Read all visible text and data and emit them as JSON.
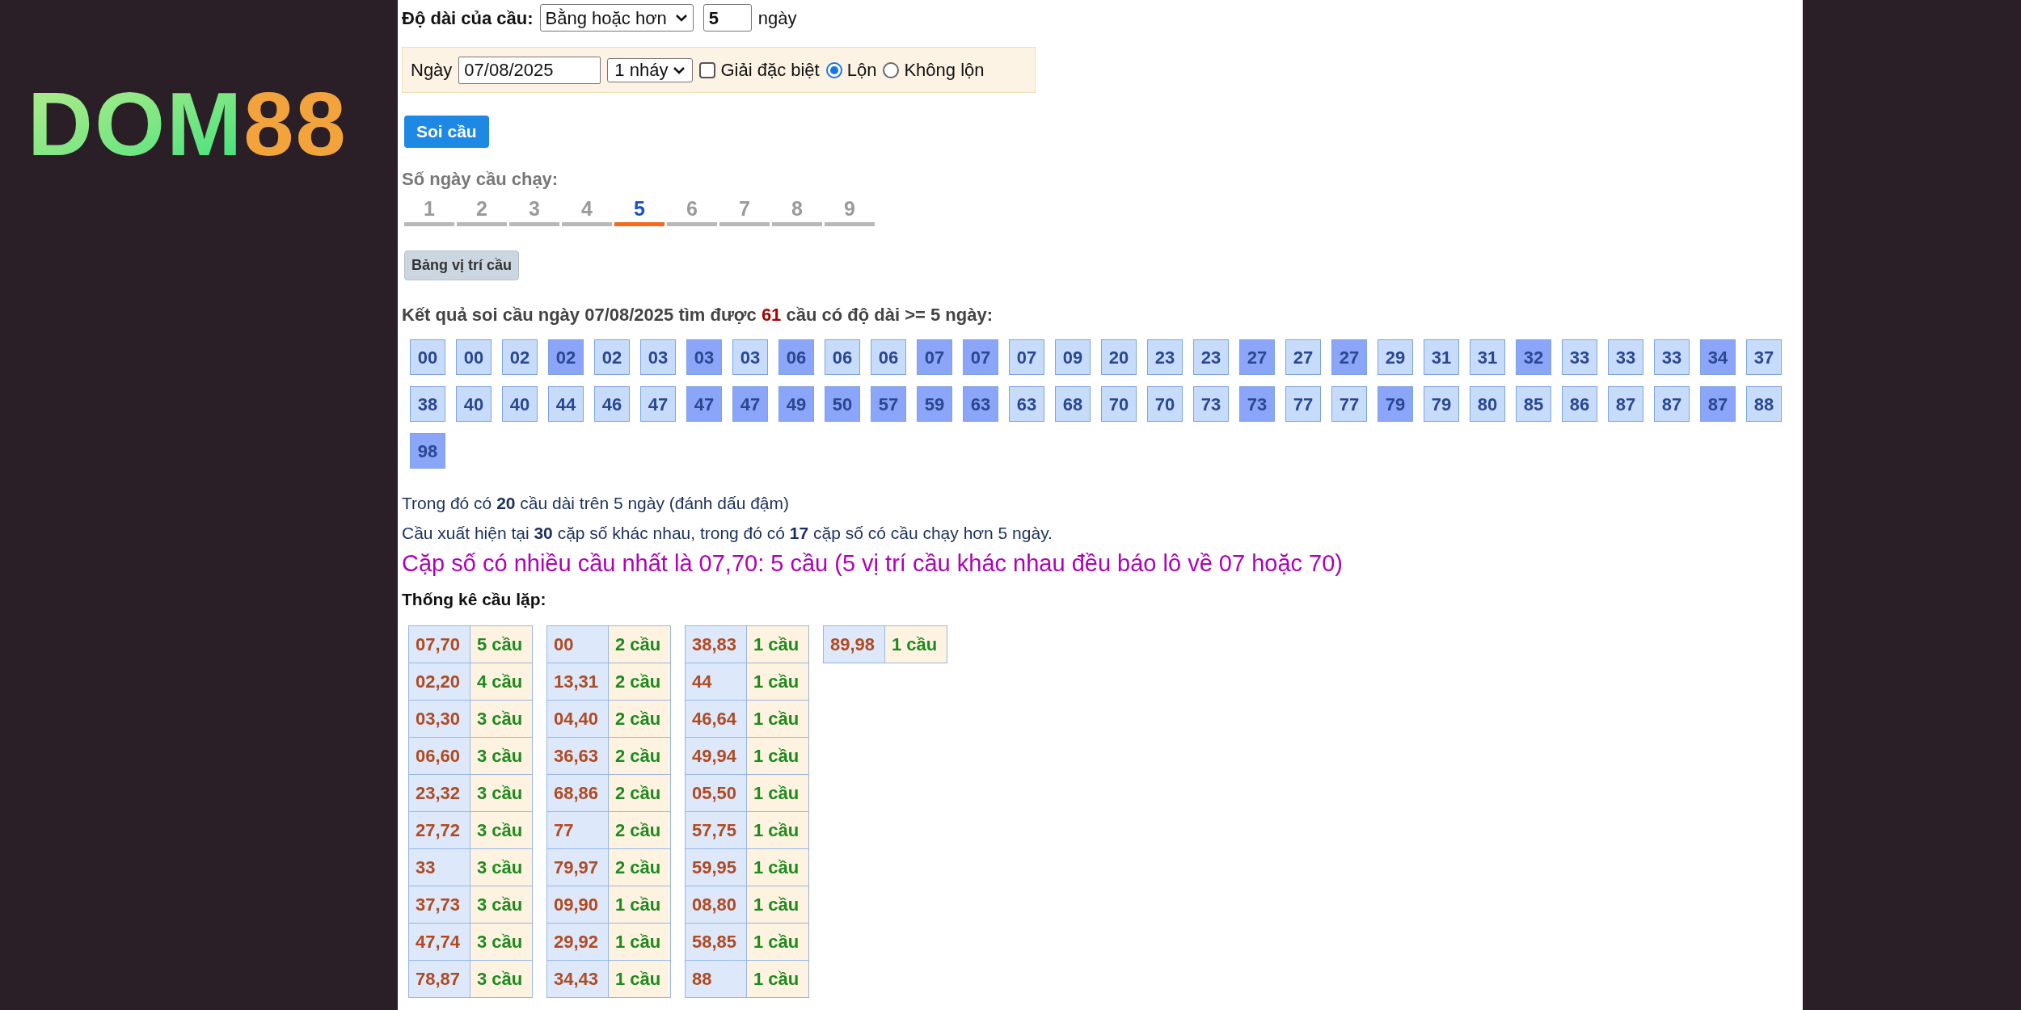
{
  "logo": {
    "text": "DOM",
    "accent": "88"
  },
  "length_filter": {
    "label": "Độ dài của cầu:",
    "mode": "Bằng hoặc hơn",
    "days": "5",
    "unit": "ngày"
  },
  "date_bar": {
    "label": "Ngày",
    "date": "07/08/2025",
    "count": "1 nháy",
    "options": [
      {
        "kind": "checkbox",
        "label": "Giải đặc biệt",
        "checked": false
      },
      {
        "kind": "radio",
        "label": "Lộn",
        "selected": true
      },
      {
        "kind": "radio",
        "label": "Không lộn",
        "selected": false
      }
    ]
  },
  "submit_button": "Soi cầu",
  "day_tabs": {
    "label": "Số ngày cầu chạy:",
    "tabs": [
      {
        "label": "1",
        "selected": false
      },
      {
        "label": "2",
        "selected": false
      },
      {
        "label": "3",
        "selected": false
      },
      {
        "label": "4",
        "selected": false
      },
      {
        "label": "5",
        "selected": true
      },
      {
        "label": "6",
        "selected": false
      },
      {
        "label": "7",
        "selected": false
      },
      {
        "label": "8",
        "selected": false
      },
      {
        "label": "9",
        "selected": false
      }
    ]
  },
  "position_button": "Bảng vị trí cầu",
  "result": {
    "before": "Kết quả soi cầu ngày 07/08/2025 tìm được",
    "count": "61",
    "after": "cầu có độ dài >= 5 ngày:"
  },
  "numbers": [
    {
      "value": "00",
      "long": false
    },
    {
      "value": "00",
      "long": false
    },
    {
      "value": "02",
      "long": false
    },
    {
      "value": "02",
      "long": true
    },
    {
      "value": "02",
      "long": false
    },
    {
      "value": "03",
      "long": false
    },
    {
      "value": "03",
      "long": true
    },
    {
      "value": "03",
      "long": false
    },
    {
      "value": "06",
      "long": true
    },
    {
      "value": "06",
      "long": false
    },
    {
      "value": "06",
      "long": false
    },
    {
      "value": "07",
      "long": true
    },
    {
      "value": "07",
      "long": true
    },
    {
      "value": "07",
      "long": false
    },
    {
      "value": "09",
      "long": false
    },
    {
      "value": "20",
      "long": false
    },
    {
      "value": "23",
      "long": false
    },
    {
      "value": "23",
      "long": false
    },
    {
      "value": "27",
      "long": true
    },
    {
      "value": "27",
      "long": false
    },
    {
      "value": "27",
      "long": true
    },
    {
      "value": "29",
      "long": false
    },
    {
      "value": "31",
      "long": false
    },
    {
      "value": "31",
      "long": false
    },
    {
      "value": "32",
      "long": true
    },
    {
      "value": "33",
      "long": false
    },
    {
      "value": "33",
      "long": false
    },
    {
      "value": "33",
      "long": false
    },
    {
      "value": "34",
      "long": true
    },
    {
      "value": "37",
      "long": false
    },
    {
      "value": "38",
      "long": false
    },
    {
      "value": "40",
      "long": false
    },
    {
      "value": "40",
      "long": false
    },
    {
      "value": "44",
      "long": false
    },
    {
      "value": "46",
      "long": false
    },
    {
      "value": "47",
      "long": false
    },
    {
      "value": "47",
      "long": true
    },
    {
      "value": "47",
      "long": true
    },
    {
      "value": "49",
      "long": true
    },
    {
      "value": "50",
      "long": true
    },
    {
      "value": "57",
      "long": true
    },
    {
      "value": "59",
      "long": true
    },
    {
      "value": "63",
      "long": true
    },
    {
      "value": "63",
      "long": false
    },
    {
      "value": "68",
      "long": false
    },
    {
      "value": "70",
      "long": false
    },
    {
      "value": "70",
      "long": false
    },
    {
      "value": "73",
      "long": false
    },
    {
      "value": "73",
      "long": true
    },
    {
      "value": "77",
      "long": false
    },
    {
      "value": "77",
      "long": false
    },
    {
      "value": "79",
      "long": true
    },
    {
      "value": "79",
      "long": false
    },
    {
      "value": "80",
      "long": false
    },
    {
      "value": "85",
      "long": false
    },
    {
      "value": "86",
      "long": false
    },
    {
      "value": "87",
      "long": false
    },
    {
      "value": "87",
      "long": false
    },
    {
      "value": "87",
      "long": true
    },
    {
      "value": "88",
      "long": false
    },
    {
      "value": "98",
      "long": true
    }
  ],
  "notes": [
    "Trong đó có **20** cầu dài trên 5 ngày (đánh dấu đậm)",
    "Cầu xuất hiện tại **30** cặp số khác nhau, trong đó có **17** cặp số có cầu chạy hơn 5 ngày."
  ],
  "highlight": "Cặp số có nhiều cầu nhất là 07,70: 5 cầu (5 vị trí cầu khác nhau đều báo lô về 07 hoặc 70)",
  "stats_title": "Thống kê cầu lặp:",
  "stats_tables": [
    [
      {
        "pair": "07,70",
        "count": "5 cầu"
      },
      {
        "pair": "02,20",
        "count": "4 cầu"
      },
      {
        "pair": "03,30",
        "count": "3 cầu"
      },
      {
        "pair": "06,60",
        "count": "3 cầu"
      },
      {
        "pair": "23,32",
        "count": "3 cầu"
      },
      {
        "pair": "27,72",
        "count": "3 cầu"
      },
      {
        "pair": "33",
        "count": "3 cầu"
      },
      {
        "pair": "37,73",
        "count": "3 cầu"
      },
      {
        "pair": "47,74",
        "count": "3 cầu"
      },
      {
        "pair": "78,87",
        "count": "3 cầu"
      }
    ],
    [
      {
        "pair": "00",
        "count": "2 cầu"
      },
      {
        "pair": "13,31",
        "count": "2 cầu"
      },
      {
        "pair": "04,40",
        "count": "2 cầu"
      },
      {
        "pair": "36,63",
        "count": "2 cầu"
      },
      {
        "pair": "68,86",
        "count": "2 cầu"
      },
      {
        "pair": "77",
        "count": "2 cầu"
      },
      {
        "pair": "79,97",
        "count": "2 cầu"
      },
      {
        "pair": "09,90",
        "count": "1 cầu"
      },
      {
        "pair": "29,92",
        "count": "1 cầu"
      },
      {
        "pair": "34,43",
        "count": "1 cầu"
      }
    ],
    [
      {
        "pair": "38,83",
        "count": "1 cầu"
      },
      {
        "pair": "44",
        "count": "1 cầu"
      },
      {
        "pair": "46,64",
        "count": "1 cầu"
      },
      {
        "pair": "49,94",
        "count": "1 cầu"
      },
      {
        "pair": "05,50",
        "count": "1 cầu"
      },
      {
        "pair": "57,75",
        "count": "1 cầu"
      },
      {
        "pair": "59,95",
        "count": "1 cầu"
      },
      {
        "pair": "08,80",
        "count": "1 cầu"
      },
      {
        "pair": "58,85",
        "count": "1 cầu"
      },
      {
        "pair": "88",
        "count": "1 cầu"
      }
    ],
    [
      {
        "pair": "89,98",
        "count": "1 cầu"
      }
    ]
  ]
}
